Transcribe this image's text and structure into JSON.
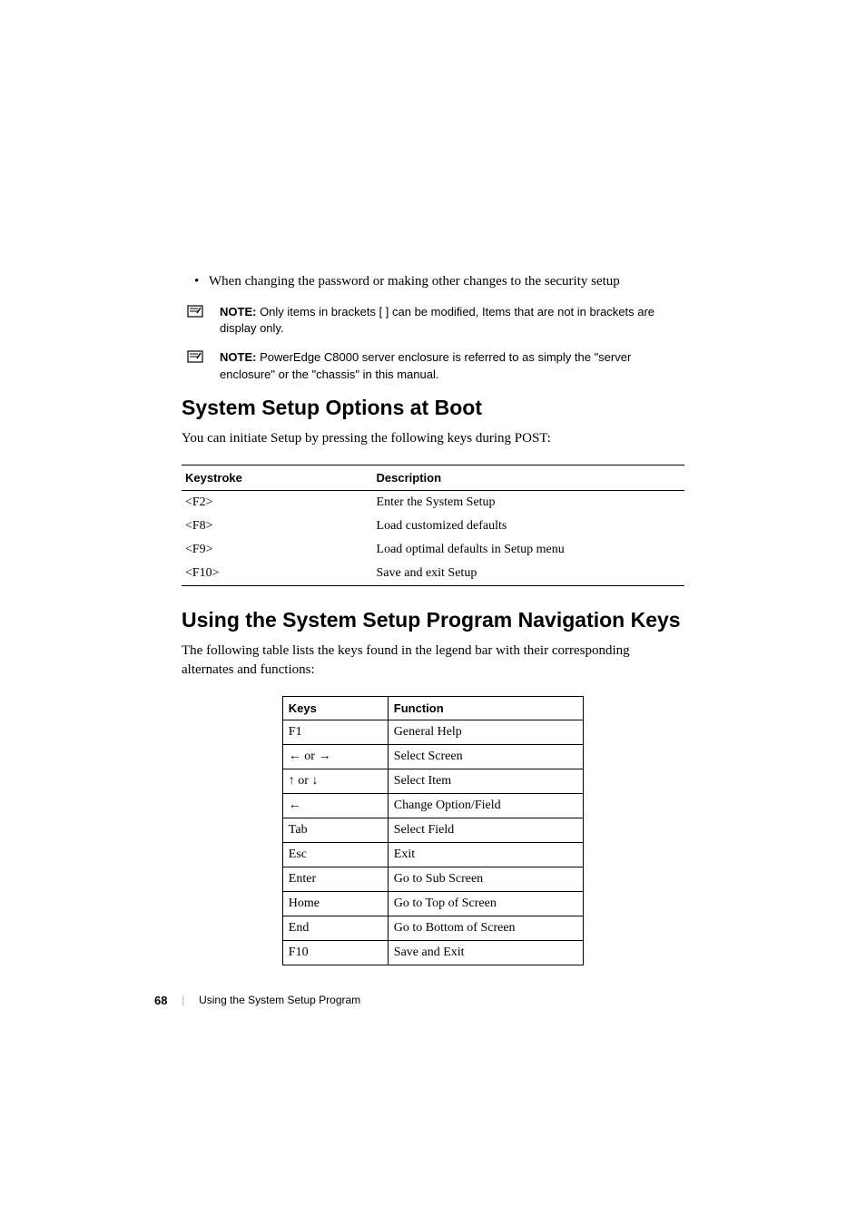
{
  "bullet": {
    "dot": "•",
    "text": "When changing the password or making other changes to the security setup"
  },
  "notes": [
    {
      "label": "NOTE:",
      "text": " Only items in brackets [ ] can be modified, Items that are not in brackets are display only."
    },
    {
      "label": "NOTE:",
      "text": " PowerEdge C8000 server enclosure is referred to as simply the \"server enclosure\" or the \"chassis\" in this manual."
    }
  ],
  "section1": {
    "heading": "System Setup Options at Boot",
    "intro": "You can initiate Setup by pressing the following keys during POST:",
    "th1": "Keystroke",
    "th2": "Description",
    "rows": [
      {
        "k": "<F2>",
        "d": "Enter the System Setup"
      },
      {
        "k": "<F8>",
        "d": "Load customized defaults"
      },
      {
        "k": "<F9>",
        "d": "Load optimal defaults in Setup menu"
      },
      {
        "k": "<F10>",
        "d": "Save and exit Setup"
      }
    ]
  },
  "section2": {
    "heading": "Using the System Setup Program Navigation Keys",
    "intro": "The following table lists the keys found in the legend bar with their corresponding alternates and functions:",
    "th1": "Keys",
    "th2": "Function",
    "rows": [
      {
        "k": "F1",
        "d": "General Help"
      },
      {
        "k": "← or →",
        "d": "Select Screen"
      },
      {
        "k": "↑ or ↓",
        "d": "Select Item"
      },
      {
        "k": "←",
        "d": "Change Option/Field"
      },
      {
        "k": "Tab",
        "d": "Select Field"
      },
      {
        "k": "Esc",
        "d": "Exit"
      },
      {
        "k": "Enter",
        "d": "Go to Sub Screen"
      },
      {
        "k": "Home",
        "d": "Go to Top of Screen"
      },
      {
        "k": "End",
        "d": "Go to Bottom of Screen"
      },
      {
        "k": "F10",
        "d": "Save and Exit"
      }
    ]
  },
  "footer": {
    "page": "68",
    "divider": "|",
    "text": "Using the System Setup Program"
  }
}
